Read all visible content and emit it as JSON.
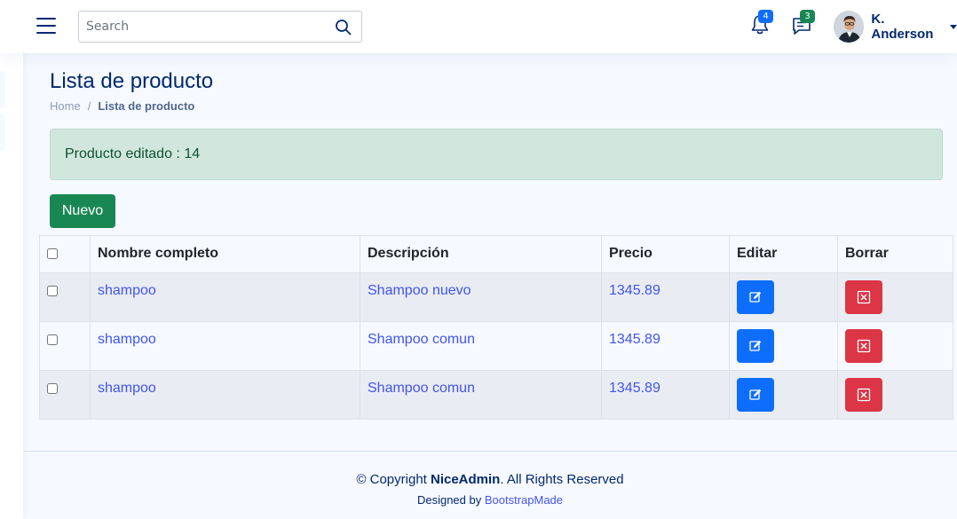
{
  "header": {
    "search_placeholder": "Search",
    "notifications_count": "4",
    "messages_count": "3",
    "user_name": "K. Anderson"
  },
  "page": {
    "title": "Lista de producto",
    "breadcrumb_home": "Home",
    "breadcrumb_separator": "/",
    "breadcrumb_current": "Lista de producto"
  },
  "alert": {
    "message": "Producto editado : 14"
  },
  "actions": {
    "new_label": "Nuevo"
  },
  "table": {
    "headers": [
      "Nombre completo",
      "Descripción",
      "Precio",
      "Editar",
      "Borrar"
    ],
    "rows": [
      {
        "name": "shampoo",
        "description": "Shampoo nuevo",
        "price": "1345.89"
      },
      {
        "name": "shampoo",
        "description": "Shampoo comun",
        "price": "1345.89"
      },
      {
        "name": "shampoo",
        "description": "Shampoo comun",
        "price": "1345.89"
      }
    ]
  },
  "footer": {
    "copyright_prefix": "© Copyright ",
    "brand": "NiceAdmin",
    "copyright_suffix": ". All Rights Reserved",
    "designed_by": "Designed by ",
    "designer": "BootstrapMade"
  },
  "colors": {
    "primary_text": "#012970",
    "link": "#4154f1",
    "success": "#198754",
    "edit": "#0d6efd",
    "delete": "#dc3545",
    "alert_bg": "#d1e7dd"
  }
}
